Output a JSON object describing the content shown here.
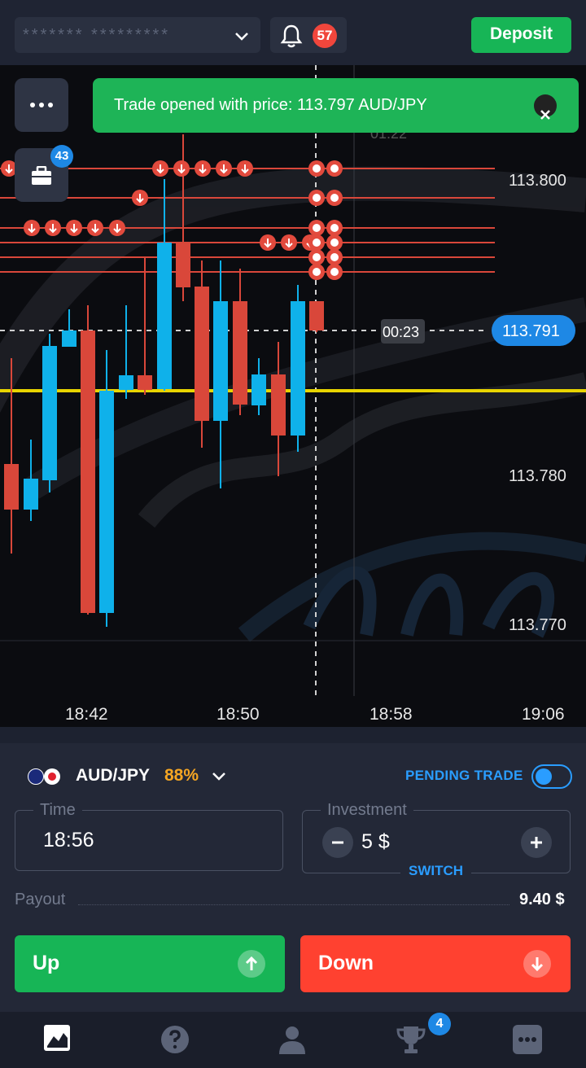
{
  "header": {
    "account_masked": "******* *********",
    "notifications_count": "57",
    "deposit_label": "Deposit"
  },
  "chart": {
    "portfolio_count": "43",
    "toast_text": "Trade opened with price: 113.797 AUD/JPY",
    "price_axis": [
      "113.800",
      "113.780",
      "113.770"
    ],
    "time_axis": [
      "18:42",
      "18:50",
      "18:58",
      "19:06"
    ],
    "current_price": "113.791",
    "countdown": "00:23",
    "faded_time": "01:22"
  },
  "chart_data": {
    "type": "candlestick",
    "pair": "AUD/JPY",
    "current_price": 113.791,
    "opened_trade_price": 113.797,
    "y_ticks": [
      113.8,
      113.78,
      113.77
    ],
    "x_ticks": [
      "18:42",
      "18:50",
      "18:58",
      "19:06"
    ],
    "colors": {
      "up": "#0fb1ea",
      "down": "#d9473a"
    }
  },
  "trade": {
    "pair": "AUD/JPY",
    "payout_pct": "88%",
    "pending_label": "PENDING TRADE",
    "time_label": "Time",
    "time_value": "18:56",
    "investment_label": "Investment",
    "investment_value": "5 $",
    "switch_label": "SWITCH",
    "payout_label": "Payout",
    "payout_value": "9.40 $",
    "up_label": "Up",
    "down_label": "Down"
  },
  "nav": {
    "achievements_count": "4"
  },
  "colors": {
    "green": "#17b556",
    "red": "#ff4130",
    "blue": "#2a9dff",
    "orange": "#f5a623"
  }
}
